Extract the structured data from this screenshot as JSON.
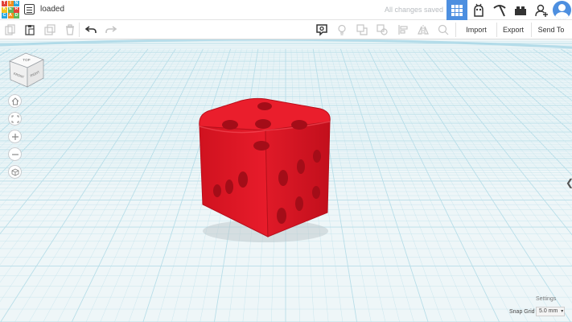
{
  "header": {
    "logo_letters": [
      "TIN",
      "KER",
      "CAD"
    ],
    "logo_colors": [
      "#e2433a",
      "#f38f1d",
      "#2aa7de",
      "#f4c21a",
      "#5cb85c",
      "#e2433a",
      "#2aa7de",
      "#f38f1d",
      "#5cb85c"
    ],
    "design_name": "loaded",
    "save_status": "All changes saved",
    "views": [
      "3d-design-view",
      "blocks-view",
      "bricks-view",
      "sim-lab-view"
    ],
    "add_user_icon": "add-user-icon",
    "avatar_icon": "user-avatar-icon"
  },
  "toolbar": {
    "edit_tools": [
      "copy-icon",
      "paste-icon",
      "duplicate-icon",
      "delete-icon",
      "undo-icon",
      "redo-icon"
    ],
    "shape_tools": [
      "notes-icon",
      "light-icon",
      "group-icon",
      "ungroup-icon",
      "align-icon",
      "mirror-icon",
      "cruise-icon"
    ],
    "import_label": "Import",
    "export_label": "Export",
    "send_to_label": "Send To"
  },
  "viewcube": {
    "top_label": "TOP",
    "front_label": "FRONT",
    "right_label": "RIGHT"
  },
  "nav_controls": [
    "home-icon",
    "fit-view-icon",
    "zoom-in-icon",
    "zoom-out-icon",
    "ortho-icon"
  ],
  "bottom": {
    "settings_label": "Settings",
    "snap_grid_label": "Snap Grid",
    "snap_grid_value": "5.0 mm"
  },
  "colors": {
    "accent": "#4d8fe0",
    "dice_red": "#e31b2a",
    "grid_line": "#b6dde8",
    "workplane_bg": "#eef6f8"
  }
}
